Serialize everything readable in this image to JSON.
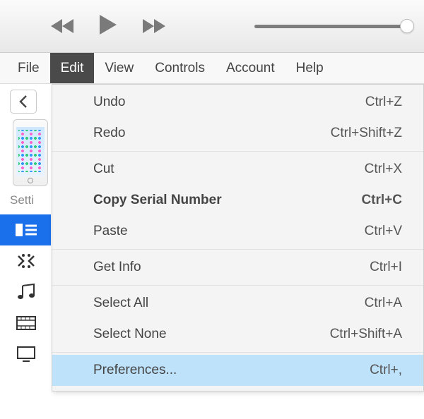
{
  "menubar": {
    "items": [
      "File",
      "Edit",
      "View",
      "Controls",
      "Account",
      "Help"
    ],
    "active_index": 1
  },
  "volume": {
    "percent": 98
  },
  "sidebar": {
    "settings_label": "Setti",
    "icons": [
      "list",
      "apps",
      "music",
      "video",
      "tv"
    ]
  },
  "edit_menu": {
    "sections": [
      [
        {
          "label": "Undo",
          "shortcut": "Ctrl+Z",
          "strong": false
        },
        {
          "label": "Redo",
          "shortcut": "Ctrl+Shift+Z",
          "strong": false
        }
      ],
      [
        {
          "label": "Cut",
          "shortcut": "Ctrl+X",
          "strong": false
        },
        {
          "label": "Copy Serial Number",
          "shortcut": "Ctrl+C",
          "strong": true
        },
        {
          "label": "Paste",
          "shortcut": "Ctrl+V",
          "strong": false
        }
      ],
      [
        {
          "label": "Get Info",
          "shortcut": "Ctrl+I",
          "strong": false
        }
      ],
      [
        {
          "label": "Select All",
          "shortcut": "Ctrl+A",
          "strong": false
        },
        {
          "label": "Select None",
          "shortcut": "Ctrl+Shift+A",
          "strong": false
        }
      ],
      [
        {
          "label": "Preferences...",
          "shortcut": "Ctrl+,",
          "strong": false,
          "hover": true
        }
      ]
    ]
  }
}
